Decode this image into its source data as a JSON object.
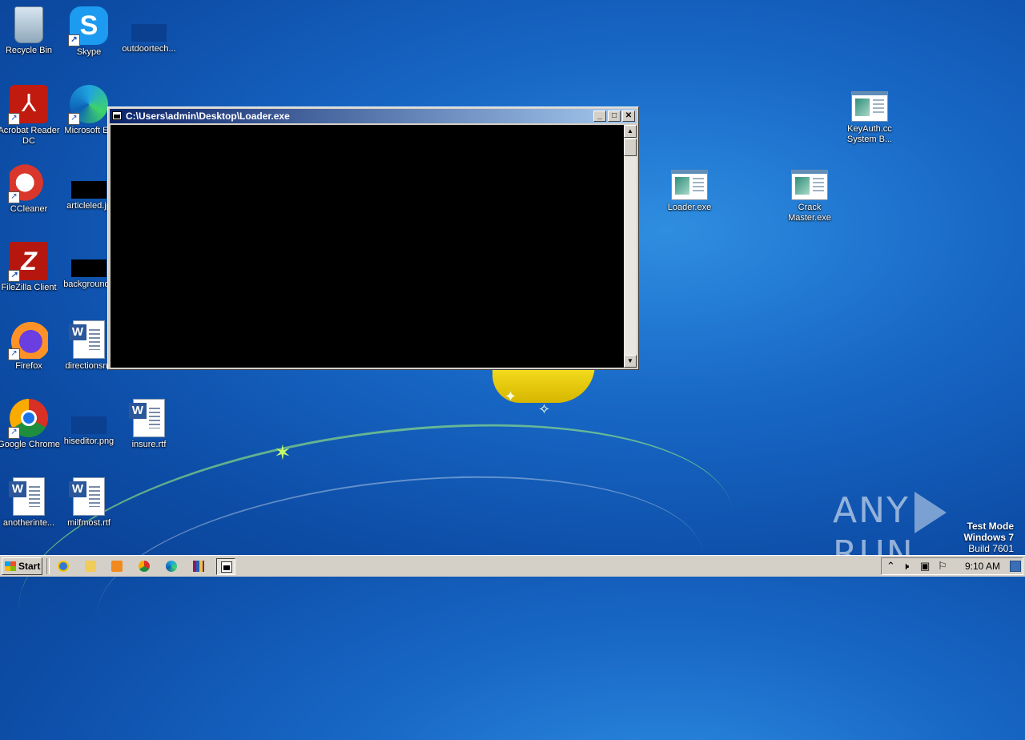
{
  "desktop": {
    "icons": [
      {
        "id": "recycle-bin",
        "label": "Recycle Bin"
      },
      {
        "id": "skype",
        "label": "Skype",
        "glyph": "S"
      },
      {
        "id": "outdoortech",
        "label": "outdoortech..."
      },
      {
        "id": "acrobat",
        "label": "Acrobat Reader DC",
        "glyph": "⅄"
      },
      {
        "id": "edge",
        "label": "Microsoft Ed"
      },
      {
        "id": "ccleaner",
        "label": "CCleaner"
      },
      {
        "id": "articleled",
        "label": "articleled.jp"
      },
      {
        "id": "filezilla",
        "label": "FileZilla Client",
        "glyph": "Z"
      },
      {
        "id": "background",
        "label": "backgroundo"
      },
      {
        "id": "firefox",
        "label": "Firefox"
      },
      {
        "id": "directionsna",
        "label": "directionsna"
      },
      {
        "id": "chrome",
        "label": "Google Chrome"
      },
      {
        "id": "hiseditor",
        "label": "hiseditor.png"
      },
      {
        "id": "insure",
        "label": "insure.rtf"
      },
      {
        "id": "anotherinte",
        "label": "anotherinte..."
      },
      {
        "id": "milfmost",
        "label": "milfmost.rtf"
      },
      {
        "id": "keyauth",
        "label": "KeyAuth.cc System B..."
      },
      {
        "id": "loader",
        "label": "Loader.exe"
      },
      {
        "id": "crackmaster",
        "label": "Crack Master.exe"
      }
    ],
    "word_glyph": "W",
    "shortcut_glyph": "↗"
  },
  "console_window": {
    "title": "C:\\Users\\admin\\Desktop\\Loader.exe",
    "buttons": {
      "minimize": "_",
      "maximize": "□",
      "close": "✕"
    },
    "scroll": {
      "up": "▲",
      "down": "▼"
    }
  },
  "watermark": {
    "brand_left": "ANY",
    "brand_right": "RUN",
    "line1": "Test Mode",
    "line2": "Windows 7",
    "line3": "Build 7601"
  },
  "taskbar": {
    "start_label": "Start",
    "apps": [
      "internet-explorer",
      "explorer",
      "media-player",
      "chrome",
      "edge",
      "winrar",
      "loader-console"
    ],
    "tray": {
      "chevron": "⌃",
      "volume": "🕨",
      "network": "▣",
      "flag": "⚐",
      "time": "9:10 AM"
    }
  },
  "colors": {
    "desktop_blue": "#1868c6",
    "titlebar_start": "#0a246a",
    "titlebar_end": "#a6caf0",
    "console_bg": "#000000",
    "taskbar": "#d4d0c8"
  }
}
